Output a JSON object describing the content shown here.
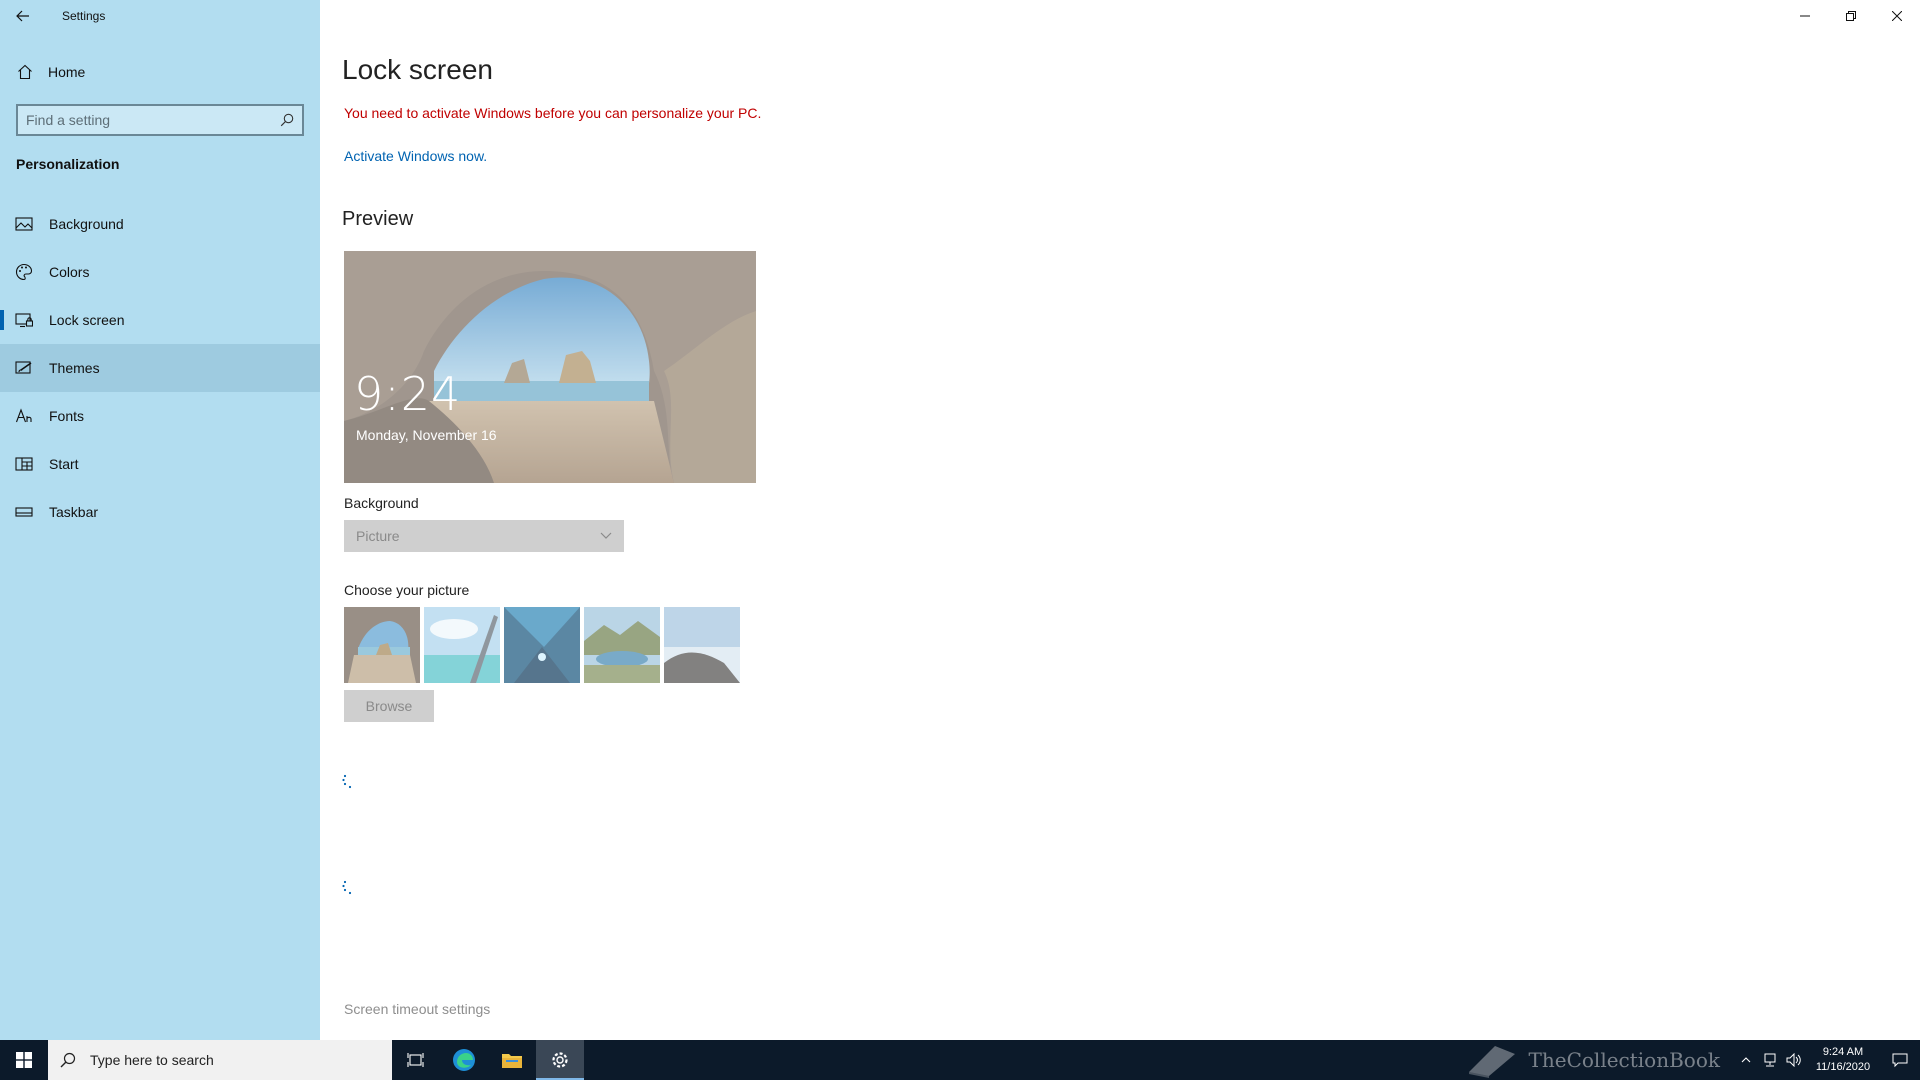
{
  "window": {
    "title": "Settings",
    "controls": {
      "minimize": "minimize",
      "restore": "restore",
      "close": "close"
    }
  },
  "sidebar": {
    "home_label": "Home",
    "search_placeholder": "Find a setting",
    "section_title": "Personalization",
    "items": [
      {
        "label": "Background",
        "icon": "picture-icon"
      },
      {
        "label": "Colors",
        "icon": "palette-icon"
      },
      {
        "label": "Lock screen",
        "icon": "monitor-lock-icon",
        "active": true
      },
      {
        "label": "Themes",
        "icon": "brush-icon",
        "hover": true
      },
      {
        "label": "Fonts",
        "icon": "font-icon"
      },
      {
        "label": "Start",
        "icon": "start-grid-icon"
      },
      {
        "label": "Taskbar",
        "icon": "taskbar-icon"
      }
    ]
  },
  "main": {
    "title": "Lock screen",
    "activation_warning": "You need to activate Windows before you can personalize your PC.",
    "activate_link": "Activate Windows now.",
    "preview_heading": "Preview",
    "preview_time": "9:24",
    "preview_date": "Monday, November 16",
    "background_label": "Background",
    "background_value": "Picture",
    "choose_label": "Choose your picture",
    "browse_label": "Browse",
    "timeout_link": "Screen timeout settings"
  },
  "taskbar": {
    "search_placeholder": "Type here to search",
    "clock_time": "9:24 AM",
    "clock_date": "11/16/2020",
    "watermark": "TheCollectionBook"
  },
  "colors": {
    "sidebar_bg": "#b2ddf0",
    "accent": "#0063b1",
    "warning": "#c00000",
    "taskbar_bg": "#0c1a2a"
  }
}
